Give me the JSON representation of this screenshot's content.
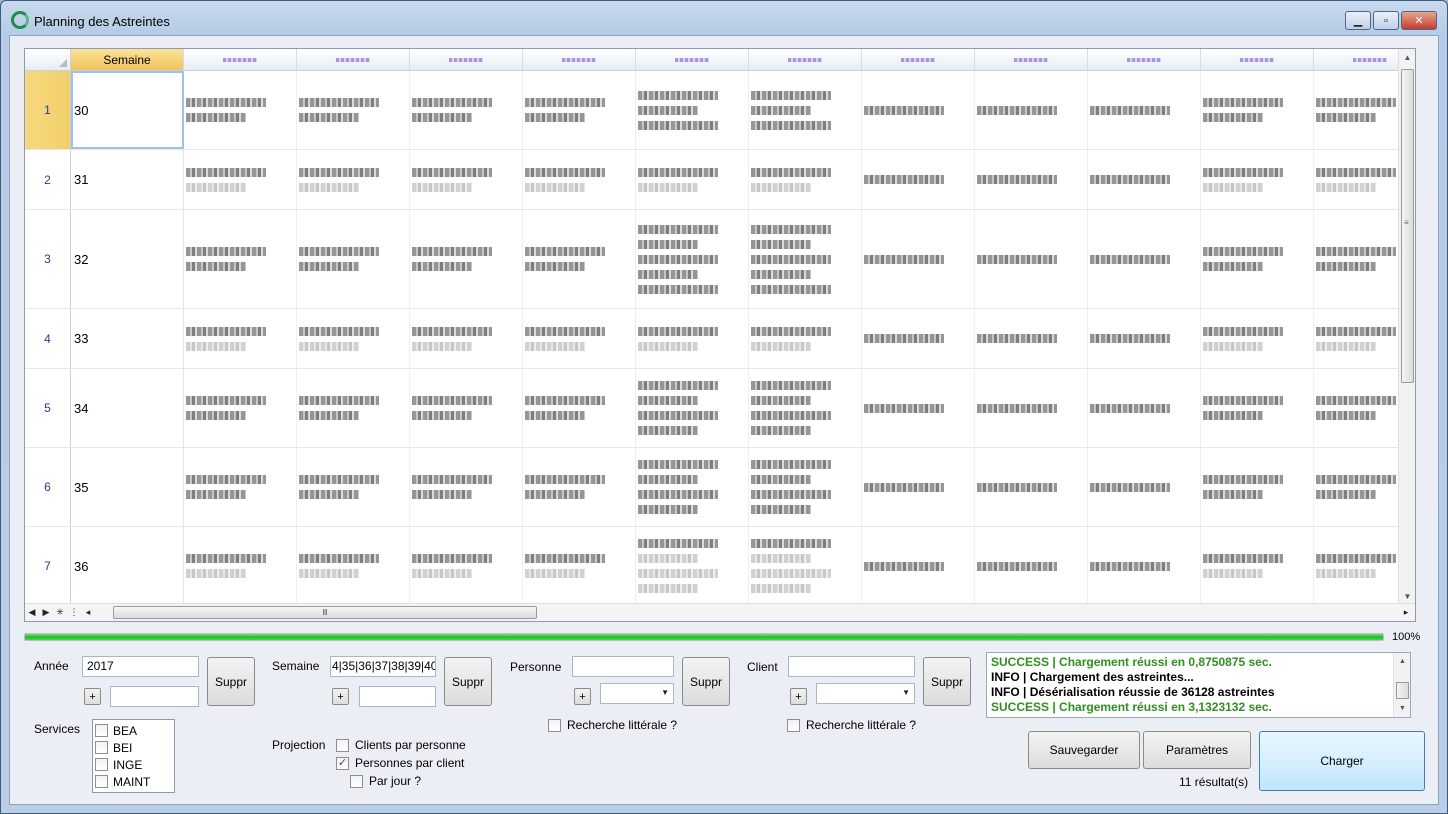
{
  "window": {
    "title": "Planning des Astreintes",
    "buttons": {
      "minimize": "▁",
      "maximize": "▫",
      "close": "✕"
    }
  },
  "grid": {
    "corner_label": "",
    "semaine_header": "Semaine",
    "data_columns": 11,
    "rows": [
      {
        "num": "1",
        "semaine": "30",
        "lines": 3
      },
      {
        "num": "2",
        "semaine": "31",
        "lines": 2
      },
      {
        "num": "3",
        "semaine": "32",
        "lines": 5
      },
      {
        "num": "4",
        "semaine": "33",
        "lines": 2
      },
      {
        "num": "5",
        "semaine": "34",
        "lines": 4
      },
      {
        "num": "6",
        "semaine": "35",
        "lines": 4
      },
      {
        "num": "7",
        "semaine": "36",
        "lines": 4
      }
    ],
    "nav": {
      "prev": "◀",
      "next": "▶",
      "new_row": "✳",
      "sep": "⋮"
    },
    "hscroll_grip": "Ⅲ",
    "vscroll_grip": "≡"
  },
  "progress": {
    "value": 1.0,
    "label": "100%"
  },
  "filters": {
    "annee": {
      "label": "Année",
      "value": "2017",
      "add": "+",
      "suppr": "Suppr"
    },
    "semaine": {
      "label": "Semaine",
      "value": "4|35|36|37|38|39|40",
      "add": "+",
      "suppr": "Suppr"
    },
    "personne": {
      "label": "Personne",
      "value": "",
      "add": "+",
      "suppr": "Suppr",
      "literal": "Recherche littérale ?"
    },
    "client": {
      "label": "Client",
      "value": "",
      "add": "+",
      "suppr": "Suppr",
      "literal": "Recherche littérale ?"
    }
  },
  "services": {
    "label": "Services",
    "items": [
      "BEA",
      "BEI",
      "INGE",
      "MAINT"
    ]
  },
  "projection": {
    "label": "Projection",
    "options": [
      {
        "label": "Clients par personne",
        "checked": false
      },
      {
        "label": "Personnes par client",
        "checked": true
      },
      {
        "label": "Par jour ?",
        "checked": false
      }
    ]
  },
  "log": [
    {
      "level": "ok",
      "text": "SUCCESS | Chargement réussi en 0,8750875 sec."
    },
    {
      "level": "info",
      "text": "INFO | Chargement des astreintes..."
    },
    {
      "level": "info",
      "text": "INFO | Désérialisation réussie de 36128 astreintes"
    },
    {
      "level": "ok",
      "text": "SUCCESS | Chargement réussi en 3,1323132 sec."
    }
  ],
  "actions": {
    "save": "Sauvegarder",
    "params": "Paramètres",
    "load": "Charger",
    "results": "11 résultat(s)"
  }
}
